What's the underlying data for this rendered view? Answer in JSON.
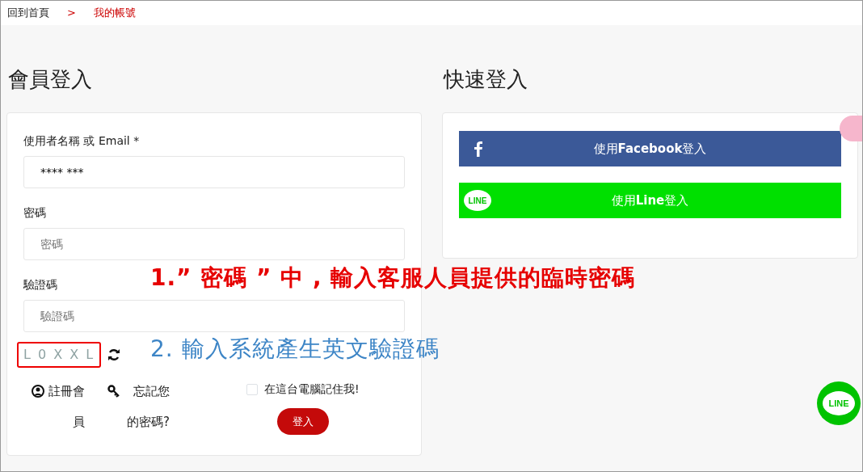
{
  "breadcrumb": [
    {
      "label": "回到首頁",
      "selected": false
    },
    {
      "label": "我的帳號",
      "selected": true
    }
  ],
  "breadcrumb_separator": ">",
  "login": {
    "title": "會員登入",
    "fields": [
      {
        "label": "使用者名稱 或 Email *",
        "value": "**** ***"
      },
      {
        "label": "密碼",
        "placeholder": "密碼"
      },
      {
        "label": "驗證碼",
        "placeholder": "驗證碼"
      }
    ],
    "captcha": "L 0 X X L",
    "register_link": "註冊會員",
    "forgot_link": "忘記您的密碼?",
    "remember": {
      "label": "在這台電腦記住我!",
      "checked": false
    },
    "submit": "登入"
  },
  "quick_login": {
    "title": "快速登入",
    "buttons": [
      {
        "kind": "facebook",
        "label": "使用**Facebook**登入"
      },
      {
        "kind": "line",
        "label": "使用**Line**登入",
        "logo_text": "LINE"
      }
    ]
  },
  "floating_line": "LINE",
  "annotations": [
    {
      "kind": "red",
      "text": "1.” 密碼 ” 中 , 輸入客服人員提供的臨時密碼"
    },
    {
      "kind": "blue",
      "text": "2. 輸入系統產生英文驗證碼"
    }
  ]
}
